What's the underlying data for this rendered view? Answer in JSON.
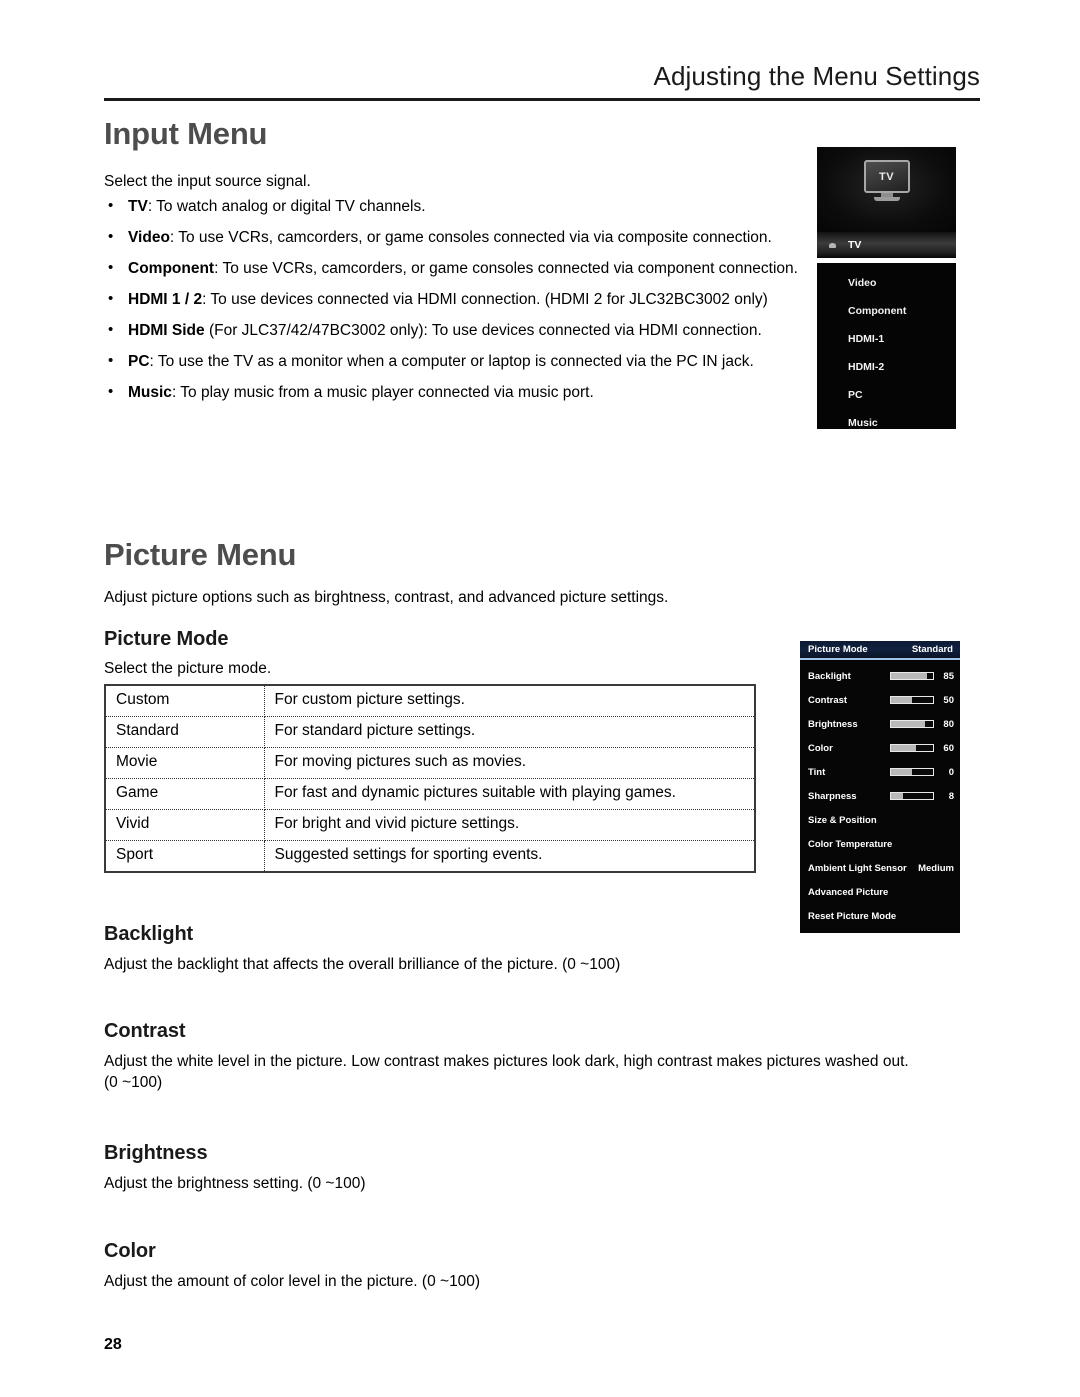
{
  "header": {
    "running_title": "Adjusting the Menu Settings"
  },
  "input_section": {
    "heading": "Input Menu",
    "intro": "Select the input source signal.",
    "bullets": [
      {
        "term": "TV",
        "text": ": To watch analog or digital TV channels."
      },
      {
        "term": "Video",
        "text": ": To use VCRs, camcorders, or game consoles connected via via composite connection."
      },
      {
        "term": "Component",
        "text": ": To use VCRs, camcorders, or game consoles connected via component connection."
      },
      {
        "term": "HDMI 1 / 2",
        "text": ": To use devices connected via HDMI connection. (HDMI 2 for JLC32BC3002 only)"
      },
      {
        "term": "HDMI Side",
        "text": " (For JLC37/42/47BC3002 only): To use devices connected via HDMI connection."
      },
      {
        "term": "PC",
        "text": ": To use the TV as a monitor when a computer or laptop is connected via the PC IN jack."
      },
      {
        "term": "Music",
        "text": ": To play music from a music player connected via music port."
      }
    ]
  },
  "input_osd": {
    "icon_label": "TV",
    "selected_item": "TV",
    "items": [
      "Video",
      "Component",
      "HDMI-1",
      "HDMI-2",
      "PC",
      "Music"
    ]
  },
  "picture_section": {
    "heading": "Picture Menu",
    "intro": "Adjust picture options such as birghtness, contrast, and advanced picture settings.",
    "picture_mode": {
      "heading": "Picture Mode",
      "intro": "Select the picture mode.",
      "rows": [
        {
          "mode": "Custom",
          "description": "For custom picture settings."
        },
        {
          "mode": "Standard",
          "description": "For standard picture settings."
        },
        {
          "mode": "Movie",
          "description": "For moving pictures such as movies."
        },
        {
          "mode": "Game",
          "description": "For fast and dynamic pictures suitable with playing games."
        },
        {
          "mode": "Vivid",
          "description": "For bright and vivid picture settings."
        },
        {
          "mode": "Sport",
          "description": "Suggested settings for sporting events."
        }
      ]
    },
    "backlight": {
      "heading": "Backlight",
      "text": "Adjust the backlight that affects the overall brilliance of the picture. (0 ~100)"
    },
    "contrast": {
      "heading": "Contrast",
      "text": "Adjust the white level in the picture. Low contrast makes pictures look dark, high contrast makes pictures washed out. (0 ~100)"
    },
    "brightness": {
      "heading": "Brightness",
      "text": "Adjust the brightness setting. (0 ~100)"
    },
    "color": {
      "heading": "Color",
      "text": "Adjust the amount of color level in the picture. (0 ~100)"
    }
  },
  "picture_osd": {
    "title": "Picture Mode",
    "title_value": "Standard",
    "rows": [
      {
        "label": "Backlight",
        "value": "85",
        "slider": 85,
        "type": "slider"
      },
      {
        "label": "Contrast",
        "value": "50",
        "slider": 50,
        "type": "slider"
      },
      {
        "label": "Brightness",
        "value": "80",
        "slider": 80,
        "type": "slider"
      },
      {
        "label": "Color",
        "value": "60",
        "slider": 60,
        "type": "slider"
      },
      {
        "label": "Tint",
        "value": "0",
        "slider": 50,
        "type": "slider"
      },
      {
        "label": "Sharpness",
        "value": "8",
        "slider": 28,
        "type": "slider"
      },
      {
        "label": "Size & Position",
        "value": "",
        "type": "plain"
      },
      {
        "label": "Color Temperature",
        "value": "",
        "type": "plain"
      },
      {
        "label": "Ambient Light Sensor",
        "value": "Medium",
        "type": "option"
      },
      {
        "label": "Advanced Picture",
        "value": "",
        "type": "plain"
      },
      {
        "label": "Reset Picture Mode",
        "value": "",
        "type": "plain"
      }
    ]
  },
  "footer": {
    "page_number": "28"
  }
}
